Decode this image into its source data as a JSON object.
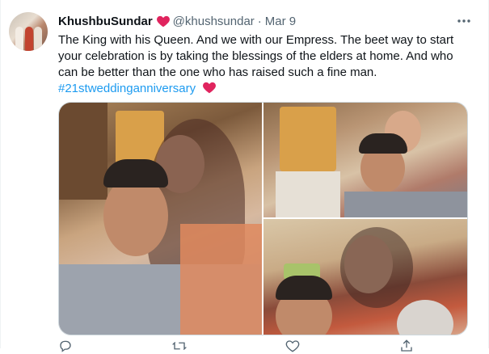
{
  "tweet": {
    "display_name": "KhushbuSundar",
    "handle": "@khushsundar",
    "separator": "·",
    "date": "Mar 9",
    "text": "The King with his Queen. And we with our Empress. The beet way to start your celebration is by taking the blessings of the elders at home. And who can be better than the one who has raised such a fine man.",
    "hashtag": "#21stweddinganniversary"
  },
  "colors": {
    "heart": "#e0245e",
    "link": "#1d9bf0",
    "secondary_text": "#536471"
  },
  "icons": [
    "heart-icon",
    "more-icon",
    "reply-icon",
    "retweet-icon",
    "like-icon",
    "share-icon"
  ]
}
